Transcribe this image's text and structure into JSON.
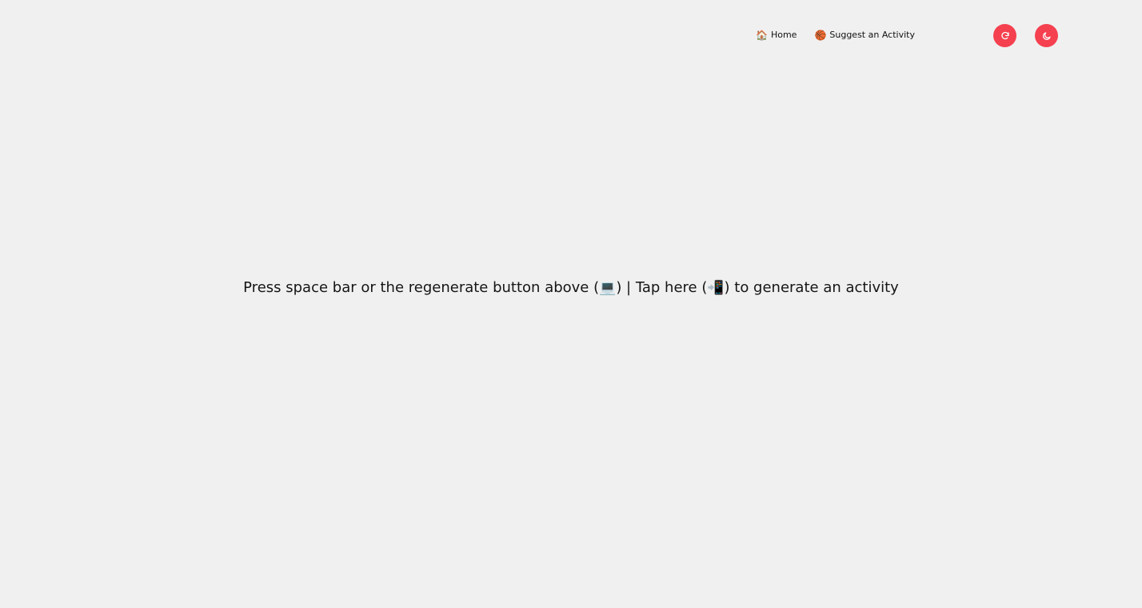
{
  "nav": {
    "home": {
      "icon": "house-icon",
      "icon_glyph": "🏠",
      "label": "Home"
    },
    "suggest": {
      "icon": "basketball-icon",
      "icon_glyph": "🏀",
      "label": "Suggest an Activity"
    }
  },
  "buttons": {
    "regenerate": {
      "icon": "refresh-icon"
    },
    "theme": {
      "icon": "moon-icon"
    }
  },
  "prompt": {
    "part1": "Press space bar or the regenerate button above (",
    "laptop_glyph": "💻",
    "part2": ") | Tap here (",
    "phone_glyph": "📲",
    "part3": ") to generate an activity"
  },
  "colors": {
    "background": "#f0f0f0",
    "accent": "#f5404f",
    "text": "#151515"
  }
}
